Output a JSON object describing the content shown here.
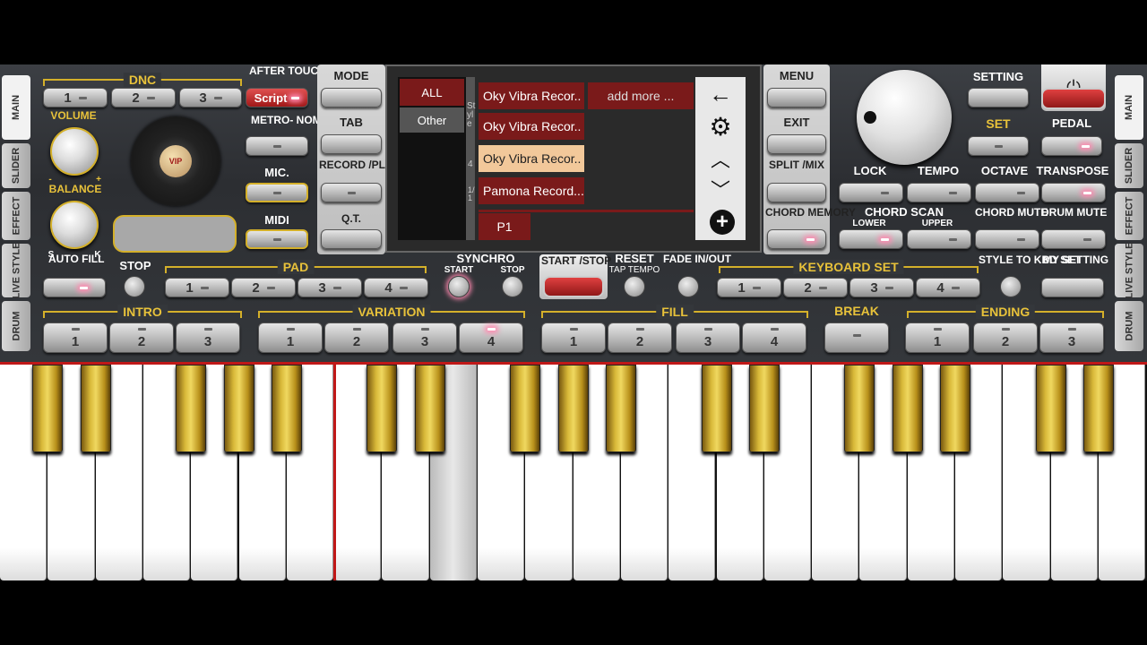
{
  "side_tabs_left": [
    "MAIN",
    "SLIDER",
    "EFFECT",
    "LIVE STYLE",
    "DRUM"
  ],
  "side_tabs_right": [
    "MAIN",
    "SLIDER",
    "EFFECT",
    "LIVE STYLE",
    "DRUM"
  ],
  "dnc": {
    "title": "DNC",
    "buttons": [
      "1",
      "2",
      "3"
    ],
    "script_label": "Script",
    "aftertouch": "AFTER TOUCH"
  },
  "volume": "VOLUME",
  "balance": "BALANCE",
  "balance_s": "S",
  "balance_k": "K",
  "vol_minus": "-",
  "vol_plus": "+",
  "disc_label": "VIP",
  "metronome": "METRO- NOME",
  "mic": "MIC.",
  "midi": "MIDI",
  "mid_left": {
    "mode": "MODE",
    "tab": "TAB",
    "record": "RECORD /PLAY",
    "qt": "Q.T."
  },
  "screen": {
    "cat_all": "ALL",
    "cat_other": "Other",
    "style_vertical": "Style",
    "page_num": "4",
    "page_frac": "1/1",
    "items": [
      "Oky Vibra Recor..",
      "Oky Vibra Recor..",
      "Oky Vibra Recor..",
      "Pamona Record..."
    ],
    "add_more": "add more ...",
    "page_tab": "P1",
    "nav": {
      "back": "←",
      "settings": "⚙",
      "up": "︿",
      "down": "﹀",
      "add": "+"
    }
  },
  "mid_right": {
    "menu": "MENU",
    "exit": "EXIT",
    "split": "SPLIT /MIX",
    "chord_memory": "CHORD MEMORY"
  },
  "right": {
    "setting": "SETTING",
    "set": "SET",
    "pedal": "PEDAL",
    "lock": "LOCK",
    "tempo": "TEMPO",
    "octave": "OCTAVE",
    "transpose": "TRANSPOSE",
    "chord_scan": "CHORD SCAN",
    "lower": "LOWER",
    "upper": "UPPER",
    "chord_mute": "CHORD MUTE",
    "drum_mute": "DRUM MUTE",
    "power": "⏻"
  },
  "row2": {
    "auto_fill": "AUTO FILL",
    "stop": "STOP",
    "pad": "PAD",
    "pad_buttons": [
      "1",
      "2",
      "3",
      "4"
    ],
    "synchro": "SYNCHRO",
    "synchro_start": "START",
    "synchro_stop": "STOP",
    "start_stop": "START /STOP",
    "reset": "RESET",
    "tap_tempo": "TAP TEMPO",
    "fade": "FADE IN/OUT",
    "keyboard_set": "KEYBOARD SET",
    "kbd_buttons": [
      "1",
      "2",
      "3",
      "4"
    ],
    "style_to_kbd": "STYLE TO KBD SET",
    "my_setting": "MY SETTING"
  },
  "row3": {
    "intro": "INTRO",
    "intro_buttons": [
      "1",
      "2",
      "3"
    ],
    "variation": "VARIATION",
    "variation_buttons": [
      "1",
      "2",
      "3",
      "4"
    ],
    "fill": "FILL",
    "fill_buttons": [
      "1",
      "2",
      "3",
      "4"
    ],
    "break": "BREAK",
    "ending": "ENDING",
    "ending_buttons": [
      "1",
      "2",
      "3"
    ]
  },
  "colors": {
    "gold": "#e8c23a",
    "red": "#c01818",
    "list_red": "#7a1a1a",
    "selected": "#f2c89a"
  }
}
